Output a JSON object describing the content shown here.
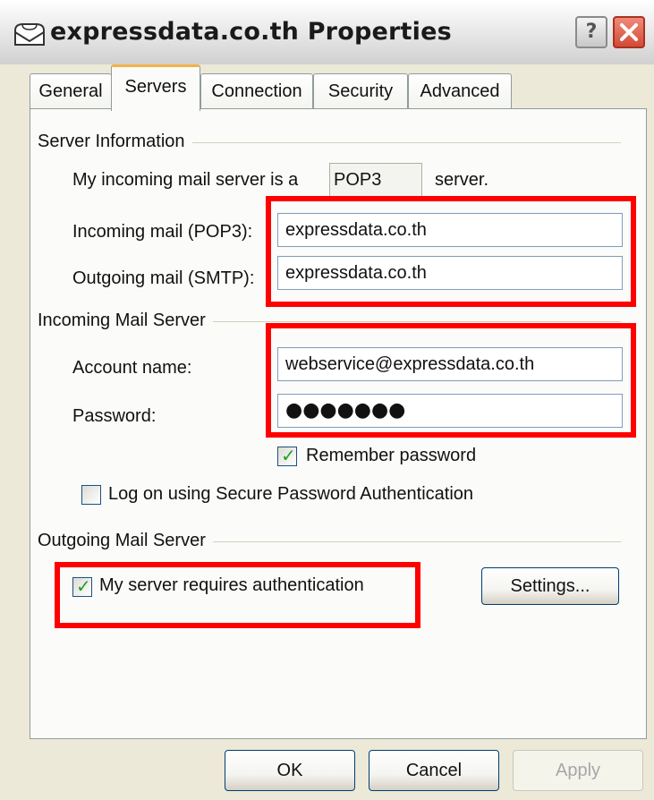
{
  "window": {
    "title": "expressdata.co.th Properties",
    "help_label": "?",
    "accent_color": "#ff0000"
  },
  "tabs": [
    {
      "label": "General",
      "active": false
    },
    {
      "label": "Servers",
      "active": true
    },
    {
      "label": "Connection",
      "active": false
    },
    {
      "label": "Security",
      "active": false
    },
    {
      "label": "Advanced",
      "active": false
    }
  ],
  "server_info": {
    "group_title": "Server Information",
    "incoming_type_prefix": "My incoming mail server is a",
    "incoming_type_value": "POP3",
    "incoming_type_suffix": "server.",
    "incoming_label": "Incoming mail (POP3):",
    "incoming_value": "expressdata.co.th",
    "outgoing_label": "Outgoing mail (SMTP):",
    "outgoing_value": "expressdata.co.th"
  },
  "incoming_server": {
    "group_title": "Incoming Mail Server",
    "account_label": "Account name:",
    "account_value": "webservice@expressdata.co.th",
    "password_label": "Password:",
    "password_value": "●●●●●●●",
    "remember_label": "Remember password",
    "remember_checked": true,
    "spa_label": "Log on using Secure Password Authentication",
    "spa_checked": false
  },
  "outgoing_server": {
    "group_title": "Outgoing Mail Server",
    "auth_label": "My server requires authentication",
    "auth_checked": true,
    "settings_label": "Settings..."
  },
  "buttons": {
    "ok": "OK",
    "cancel": "Cancel",
    "apply": "Apply"
  }
}
